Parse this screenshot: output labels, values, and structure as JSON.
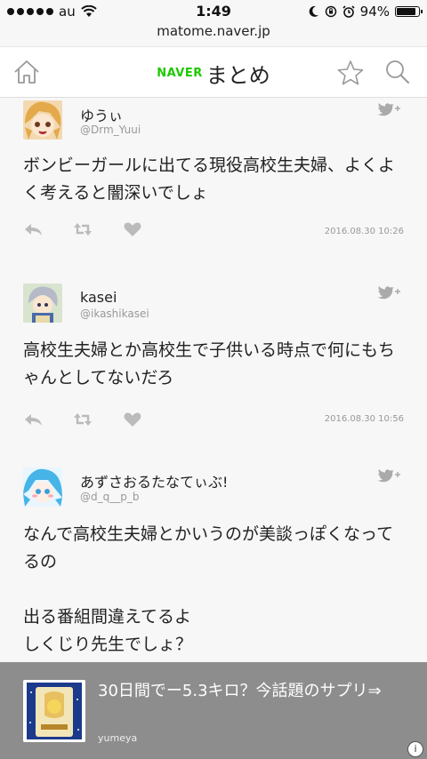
{
  "status_bar": {
    "carrier": "au",
    "time": "1:49",
    "battery": "94%",
    "battery_level": 0.94
  },
  "url_bar": {
    "url": "matome.naver.jp"
  },
  "header": {
    "brand_naver": "NAVER",
    "brand_matome": "まとめ"
  },
  "colors": {
    "naver_green": "#1ec800",
    "ad_background": "#8d8d8d"
  },
  "tweets": [
    {
      "name": "ゆうぃ",
      "handle": "@Drm_Yuui",
      "text": "ボンビーガールに出てる現役高校生夫婦、よくよく考えると闇深いでしょ",
      "timestamp": "2016.08.30 10:26"
    },
    {
      "name": "kasei",
      "handle": "@ikashikasei",
      "text": "高校生夫婦とか高校生で子供いる時点で何にもちゃんとしてないだろ",
      "timestamp": "2016.08.30 10:56"
    },
    {
      "name": "あずさおるたなてぃぶ!",
      "handle": "@d_q__p_b",
      "text": "なんで高校生夫婦とかいうのが美談っぽくなってるの\n\n出る番組間違えてるよ\nしくじり先生でしょ？",
      "timestamp": ""
    }
  ],
  "ad": {
    "title": "30日間でー5.3キロ？今話題のサプリ⇒",
    "source": "yumeya",
    "info_icon": "i"
  },
  "icons": {
    "home": "home-icon",
    "star": "star-icon",
    "search": "search-icon",
    "twitter": "twitter-follow-icon",
    "reply": "reply-icon",
    "retweet": "retweet-icon",
    "like": "heart-icon"
  }
}
